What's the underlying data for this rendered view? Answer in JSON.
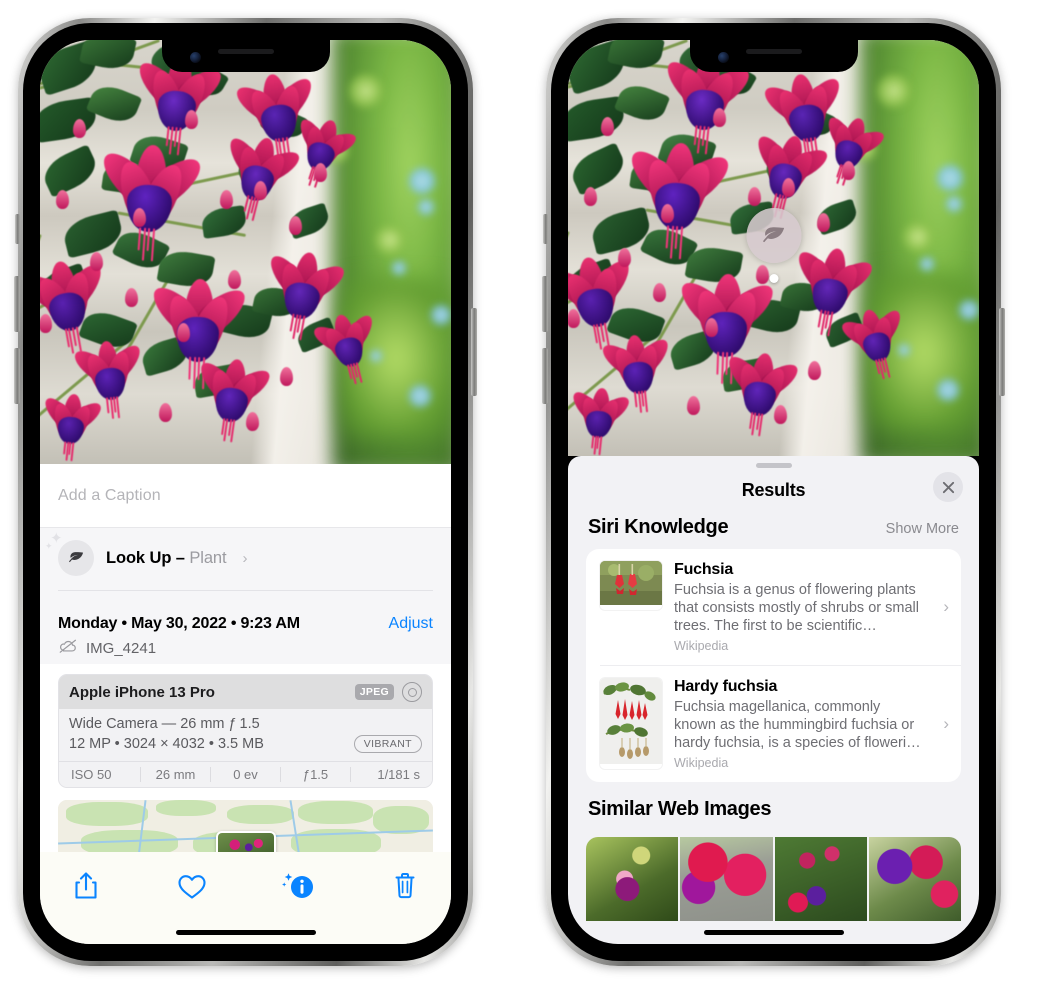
{
  "left_phone": {
    "caption_field": {
      "placeholder": "Add a Caption",
      "value": ""
    },
    "lookup": {
      "label": "Look Up – ",
      "subject": "Plant",
      "chevron": "›",
      "icon": "leaf-icon"
    },
    "meta": {
      "date": "Monday • May 30, 2022 • 9:23 AM",
      "adjust_label": "Adjust",
      "filename": "IMG_4241",
      "cloud_icon": "cloud-slash-icon"
    },
    "exif": {
      "device": "Apple iPhone 13 Pro",
      "format_badge": "JPEG",
      "raw_icon": "raw-circle-icon",
      "lens_line": "Wide Camera — 26 mm ƒ 1.5",
      "size_line": "12 MP • 3024 × 4032 • 3.5 MB",
      "style_badge": "VIBRANT",
      "stats": [
        "ISO 50",
        "26 mm",
        "0 ev",
        "ƒ1.5",
        "1/181 s"
      ]
    },
    "toolbar": [
      {
        "name": "share-button",
        "icon": "share-icon"
      },
      {
        "name": "favorite-button",
        "icon": "heart-icon"
      },
      {
        "name": "info-button",
        "icon": "info-sparkle-icon"
      },
      {
        "name": "delete-button",
        "icon": "trash-icon"
      }
    ]
  },
  "right_phone": {
    "badge": {
      "icon": "leaf-icon"
    },
    "sheet": {
      "title": "Results",
      "close_label": "✕",
      "sections": [
        {
          "title": "Siri Knowledge",
          "action": "Show More",
          "items": [
            {
              "title": "Fuchsia",
              "description": "Fuchsia is a genus of flowering plants that consists mostly of shrubs or small trees. The first to be scientific…",
              "source": "Wikipedia",
              "chevron": "›"
            },
            {
              "title": "Hardy fuchsia",
              "description": "Fuchsia magellanica, commonly known as the hummingbird fuchsia or hardy fuchsia, is a species of floweri…",
              "source": "Wikipedia",
              "chevron": "›"
            }
          ]
        },
        {
          "title": "Similar Web Images",
          "action": "",
          "items": []
        }
      ]
    }
  },
  "colors": {
    "accent_blue": "#0a84ff",
    "sheet_bg": "#f2f2f5",
    "card_bg": "#ffffff",
    "secondary_text": "#6e6e73",
    "muted_text": "#a9a9ae"
  }
}
